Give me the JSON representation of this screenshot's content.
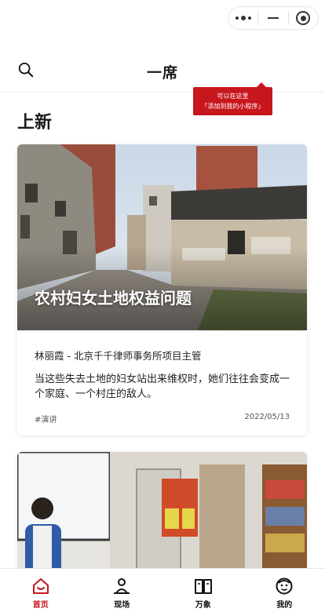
{
  "header": {
    "title": "一席"
  },
  "tooltip": {
    "line1": "可以在这里",
    "line2": "「添加到我的小程序」"
  },
  "section": {
    "title": "上新"
  },
  "cards": [
    {
      "cover_title": "农村妇女土地权益问题",
      "author": "林丽霞  -  北京千千律师事务所项目主管",
      "summary": "当这些失去土地的妇女站出来维权时，她们往往会变成一个家庭、一个村庄的敌人。",
      "tag": "#演讲",
      "date": "2022/05/13"
    },
    {
      "cover_title": ""
    }
  ],
  "tabs": [
    {
      "label": "首页",
      "icon": "home-icon",
      "active": true
    },
    {
      "label": "现场",
      "icon": "speaker-icon",
      "active": false
    },
    {
      "label": "万象",
      "icon": "book-icon",
      "active": false
    },
    {
      "label": "我的",
      "icon": "face-icon",
      "active": false
    }
  ],
  "colors": {
    "accent": "#c8161d",
    "text": "#1a1a1a"
  }
}
